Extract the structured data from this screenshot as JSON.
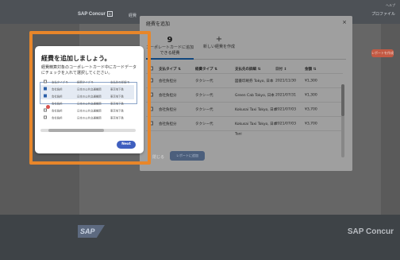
{
  "app": {
    "logo_text": "SAP Concur",
    "logo_box": "C",
    "header_tab": "経費",
    "header_right_top": "ヘルプ",
    "header_right_bottom": "プロファイル",
    "bg_button": "レポートを作成",
    "footer_sap": "SAP",
    "footer_concur": "SAP Concur"
  },
  "modal": {
    "title": "経費を追加",
    "close": "×",
    "tabs": [
      {
        "count": "9",
        "label": "コーポレートカードに追加できる経費"
      },
      {
        "count": "+",
        "label": "新しい経費を作成"
      }
    ],
    "table_headers": [
      "支払タイプ ⇅",
      "経費タイプ ⇅",
      "支払先の詳細 ⇅",
      "日付 ↕",
      "金額 ⇅"
    ],
    "rows": [
      {
        "pay_type": "会社負担分",
        "expense_type": "タクシー代",
        "vendor": "図書印刷券 Tokyo, 日本",
        "date": "2021/11/30",
        "amount": "¥1,300"
      },
      {
        "pay_type": "会社負担分",
        "expense_type": "タクシー代",
        "vendor": "Green Cab Tokyo, 日本",
        "date": "2021/07/31",
        "amount": "¥1,300"
      },
      {
        "pay_type": "会社負担分",
        "expense_type": "タクシー代",
        "vendor": "Kokusai Taxi Tokyo, 日本",
        "date": "2021/07/03",
        "amount": "¥3,700"
      },
      {
        "pay_type": "会社負担分",
        "expense_type": "タクシー代",
        "vendor": "Kokusai Taxi Tokyo, 日本",
        "date": "2021/07/03",
        "amount": "¥3,700"
      }
    ],
    "partial_row": "Taxi",
    "footer_text": "閉じる",
    "footer_button": "レポートに追加"
  },
  "walkthrough": {
    "title": "経費を追加しましょう。",
    "description": "経費精算対象のコーポレートカード中にカードデータにチェックを入れて選択してください。",
    "mini_headers": [
      "支払タイプ ⇅",
      "経費タイプ ⇅",
      "支払先の詳細 ⇅"
    ],
    "mini_rows": [
      {
        "a": "会社負担",
        "b": "日本の公共交通機関",
        "c": "東京地下鉄",
        "checked": true,
        "selected": true
      },
      {
        "a": "会社負担",
        "b": "日本の公共交通機関",
        "c": "東京地下鉄",
        "checked": true,
        "selected": true
      },
      {
        "a": "会社負担",
        "b": "日本の公共交通機関",
        "c": "東京地下鉄",
        "checked": false,
        "selected": false
      },
      {
        "a": "会社負担",
        "b": "日本の公共交通機関",
        "c": "東京地下鉄",
        "checked": false,
        "selected": false
      },
      {
        "a": "会社負担",
        "b": "日本の公共交通機関",
        "c": "東京地下鉄",
        "checked": false,
        "selected": false
      }
    ],
    "next_label": "Next"
  }
}
